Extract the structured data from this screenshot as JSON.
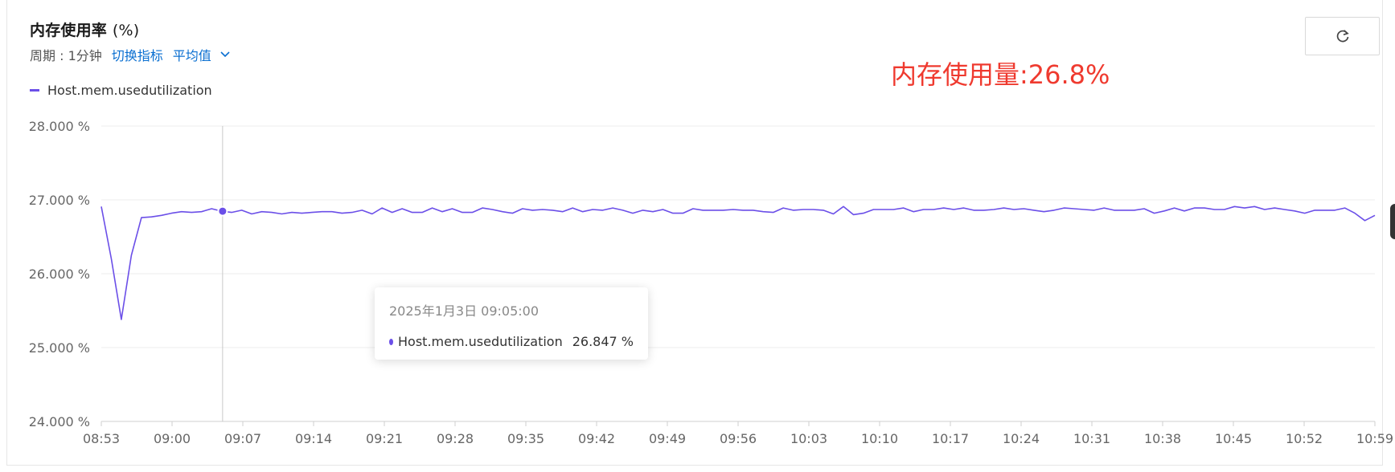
{
  "header": {
    "title": "内存使用率",
    "title_unit": "(%)",
    "period_label": "周期 : 1分钟",
    "switch_metric": "切换指标",
    "aggregation": "平均值"
  },
  "icons": {
    "refresh": "refresh-icon",
    "dropdown": "chevron-down-icon"
  },
  "annotation": "内存使用量:26.8%",
  "colors": {
    "series": "#6b4fe8",
    "link": "#0a6fd1",
    "annotation": "#ef3a2f"
  },
  "tooltip": {
    "time": "2025年1月3日 09:05:00",
    "series_name": "Host.mem.usedutilization",
    "value_text": "26.847 %"
  },
  "chart_data": {
    "type": "line",
    "title": "内存使用率 (%)",
    "xlabel": "",
    "ylabel": "",
    "ylim": [
      24,
      28
    ],
    "y_ticks": [
      24,
      25,
      26,
      27,
      28
    ],
    "y_tick_labels": [
      "24.000 %",
      "25.000 %",
      "26.000 %",
      "27.000 %",
      "28.000 %"
    ],
    "x_tick_labels": [
      "08:53",
      "09:00",
      "09:07",
      "09:14",
      "09:21",
      "09:28",
      "09:35",
      "09:42",
      "09:49",
      "09:56",
      "10:03",
      "10:10",
      "10:17",
      "10:24",
      "10:31",
      "10:38",
      "10:45",
      "10:52",
      "10:59"
    ],
    "x_start": "08:53",
    "x_end": "10:59",
    "grid": true,
    "legend": "top-left",
    "highlight": {
      "x": "09:05",
      "y": 26.847
    },
    "series": [
      {
        "name": "Host.mem.usedutilization",
        "values": [
          26.91,
          26.2,
          25.38,
          26.25,
          26.76,
          26.77,
          26.79,
          26.82,
          26.84,
          26.83,
          26.84,
          26.88,
          26.847,
          26.83,
          26.86,
          26.81,
          26.84,
          26.83,
          26.81,
          26.83,
          26.82,
          26.83,
          26.84,
          26.84,
          26.82,
          26.83,
          26.86,
          26.81,
          26.89,
          26.83,
          26.88,
          26.83,
          26.83,
          26.89,
          26.84,
          26.88,
          26.83,
          26.83,
          26.89,
          26.87,
          26.84,
          26.82,
          26.88,
          26.86,
          26.87,
          26.86,
          26.84,
          26.89,
          26.84,
          26.87,
          26.86,
          26.89,
          26.86,
          26.82,
          26.86,
          26.84,
          26.87,
          26.82,
          26.82,
          26.88,
          26.86,
          26.86,
          26.86,
          26.87,
          26.86,
          26.86,
          26.84,
          26.83,
          26.89,
          26.86,
          26.87,
          26.87,
          26.86,
          26.81,
          26.91,
          26.8,
          26.82,
          26.87,
          26.87,
          26.87,
          26.89,
          26.84,
          26.87,
          26.87,
          26.89,
          26.87,
          26.89,
          26.86,
          26.86,
          26.87,
          26.89,
          26.87,
          26.88,
          26.86,
          26.84,
          26.86,
          26.89,
          26.88,
          26.87,
          26.86,
          26.89,
          26.86,
          26.86,
          26.86,
          26.88,
          26.82,
          26.85,
          26.89,
          26.85,
          26.89,
          26.89,
          26.87,
          26.87,
          26.91,
          26.89,
          26.91,
          26.87,
          26.89,
          26.87,
          26.85,
          26.82,
          26.86,
          26.86,
          26.86,
          26.89,
          26.82,
          26.72,
          26.79
        ]
      }
    ]
  }
}
